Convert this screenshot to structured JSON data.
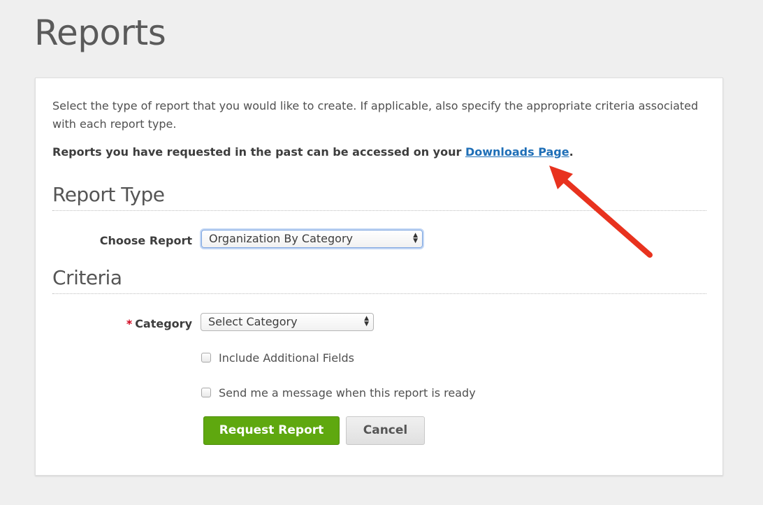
{
  "page": {
    "title": "Reports"
  },
  "intro": {
    "text": "Select the type of report that you would like to create. If applicable, also specify the appropriate criteria associated with each report type.",
    "downloads_prefix": "Reports you have requested in the past can be accessed on your ",
    "downloads_link": "Downloads Page",
    "downloads_suffix": "."
  },
  "report_type": {
    "heading": "Report Type",
    "choose_label": "Choose Report",
    "selected": "Organization By Category"
  },
  "criteria": {
    "heading": "Criteria",
    "required_marker": "*",
    "category_label": "Category",
    "category_selected": "Select Category",
    "include_fields_label": "Include Additional Fields",
    "include_fields_checked": false,
    "notify_label": "Send me a message when this report is ready",
    "notify_checked": false
  },
  "actions": {
    "request_label": "Request Report",
    "cancel_label": "Cancel"
  },
  "colors": {
    "primary": "#5fa80f",
    "link": "#1f6fb7",
    "annotation_arrow": "#e8321e",
    "required": "#d0021b"
  },
  "icons": {
    "select_arrows": "updown-arrows-icon",
    "annotation": "red-arrow-annotation"
  }
}
